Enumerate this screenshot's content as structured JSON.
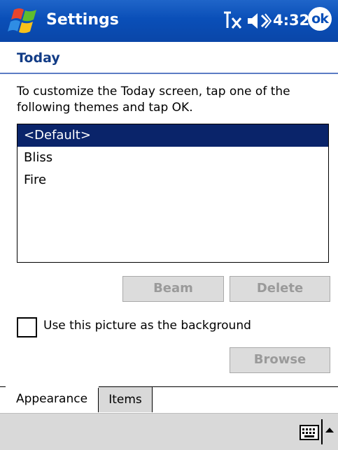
{
  "titlebar": {
    "app_title": "Settings",
    "clock": "4:32",
    "ok_label": "ok",
    "bar_color": "#0a4fb8"
  },
  "page": {
    "header": "Today",
    "instructions": "To customize the Today screen, tap one of the following themes and tap OK."
  },
  "themes": {
    "items": [
      "<Default>",
      "Bliss",
      "Fire"
    ],
    "selected_index": 0,
    "selection_color": "#0a246a"
  },
  "buttons": {
    "beam": "Beam",
    "delete": "Delete",
    "browse": "Browse"
  },
  "background_option": {
    "label": "Use this picture as the background",
    "checked": false
  },
  "tabs": [
    {
      "label": "Appearance",
      "active": true
    },
    {
      "label": "Items",
      "active": false
    }
  ],
  "icons": {
    "start": "windows-flag-icon",
    "connectivity": "connectivity-icon",
    "volume": "volume-icon",
    "keyboard": "keyboard-icon",
    "sip_arrow": "up-arrow-icon"
  }
}
